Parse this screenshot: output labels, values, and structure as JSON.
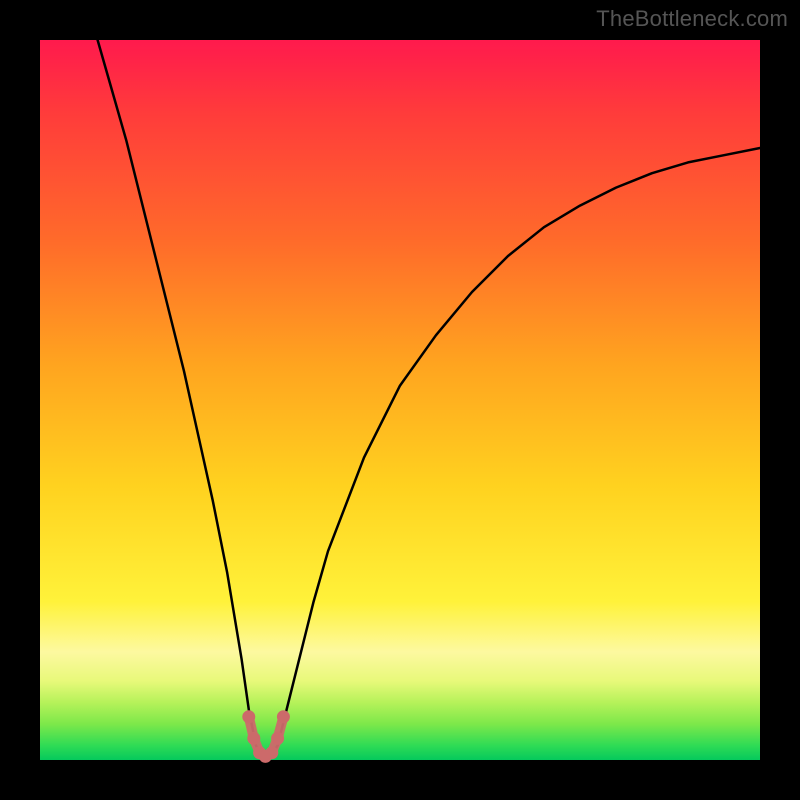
{
  "watermark": "TheBottleneck.com",
  "chart_data": {
    "type": "line",
    "title": "",
    "xlabel": "",
    "ylabel": "",
    "xlim": [
      0,
      100
    ],
    "ylim": [
      0,
      100
    ],
    "grid": false,
    "legend": false,
    "background": "rainbow-vertical-gradient",
    "series": [
      {
        "name": "bottleneck-curve",
        "color": "#000000",
        "x": [
          8,
          10,
          12,
          14,
          16,
          18,
          20,
          22,
          24,
          26,
          28,
          29,
          30,
          31,
          32,
          33,
          34,
          36,
          38,
          40,
          45,
          50,
          55,
          60,
          65,
          70,
          75,
          80,
          85,
          90,
          95,
          100
        ],
        "y": [
          100,
          93,
          86,
          78,
          70,
          62,
          54,
          45,
          36,
          26,
          14,
          7,
          2,
          0.5,
          0.5,
          2,
          6,
          14,
          22,
          29,
          42,
          52,
          59,
          65,
          70,
          74,
          77,
          79.5,
          81.5,
          83,
          84,
          85
        ]
      },
      {
        "name": "trough-markers",
        "color": "#cc6a6a",
        "marker": "circle",
        "x": [
          29,
          29.7,
          30.5,
          31.3,
          32.2,
          33,
          33.8
        ],
        "y": [
          6,
          3,
          1,
          0.5,
          1,
          3,
          6
        ]
      }
    ]
  }
}
